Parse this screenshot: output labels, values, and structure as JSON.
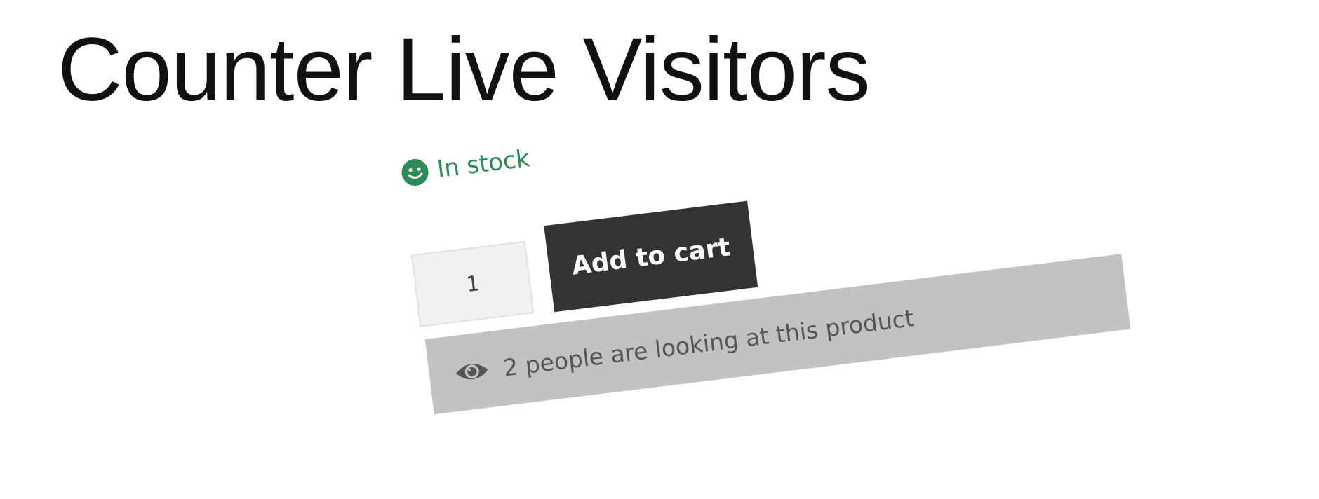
{
  "page": {
    "title": "Counter Live Visitors"
  },
  "stock": {
    "label": "In stock",
    "color": "#2e8b57",
    "icon": "smile-icon"
  },
  "cart": {
    "quantity_value": "1",
    "add_label": "Add to cart"
  },
  "visitors": {
    "icon": "eye-icon",
    "message": "2 people are looking at this product"
  }
}
